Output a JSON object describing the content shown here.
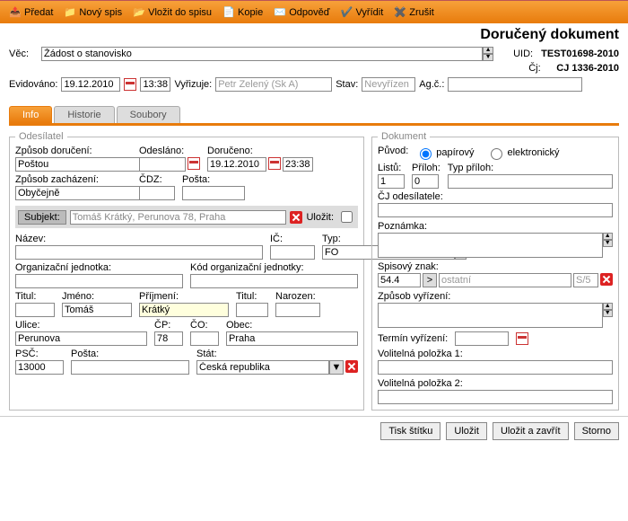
{
  "toolbar": {
    "predat": "Předat",
    "novy_spis": "Nový spis",
    "vlozit": "Vložit do spisu",
    "kopie": "Kopie",
    "odpoved": "Odpověď",
    "vyridit": "Vyřídit",
    "zrusit": "Zrušit"
  },
  "title": "Doručený dokument",
  "header": {
    "vec_lbl": "Věc:",
    "vec_val": "Žádost o stanovisko",
    "uid_lbl": "UID:",
    "uid_val": "TEST01698-2010",
    "cj_lbl": "Čj:",
    "cj_val": "CJ 1336-2010",
    "evidovano_lbl": "Evidováno:",
    "evidovano_date": "19.12.2010",
    "evidovano_time": "13:38",
    "vyrizuje_lbl": "Vyřizuje:",
    "vyrizuje_val": "Petr Zelený (Sk A)",
    "stav_lbl": "Stav:",
    "stav_val": "Nevyřízen",
    "agc_lbl": "Ag.č.:",
    "agc_val": ""
  },
  "tabs": {
    "info": "Info",
    "historie": "Historie",
    "soubory": "Soubory"
  },
  "odesilatel": {
    "legend": "Odesílatel",
    "zpusob_doruceni_lbl": "Způsob doručení:",
    "zpusob_doruceni_val": "Poštou",
    "odeslano_lbl": "Odesláno:",
    "odeslano_val": "",
    "doruceno_lbl": "Doručeno:",
    "doruceno_date": "19.12.2010",
    "doruceno_time": "23:38",
    "zpusob_zachazeni_lbl": "Způsob zacházení:",
    "zpusob_zachazeni_val": "Obyčejně",
    "cdz_lbl": "ČDZ:",
    "cdz_val": "",
    "posta_lbl": "Pošta:",
    "posta_val": "",
    "subjekt_btn": "Subjekt:",
    "subjekt_val": "Tomáš Krátký, Perunova 78, Praha",
    "ulozit_lbl": "Uložit:",
    "nazev_lbl": "Název:",
    "nazev_val": "",
    "ic_lbl": "IČ:",
    "ic_val": "",
    "typ_lbl": "Typ:",
    "typ_val": "FO",
    "orgjedn_lbl": "Organizační jednotka:",
    "orgjedn_val": "",
    "kodorg_lbl": "Kód organizační jednotky:",
    "kodorg_val": "",
    "titul_lbl": "Titul:",
    "titul_val": "",
    "jmeno_lbl": "Jméno:",
    "jmeno_val": "Tomáš",
    "prijmeni_lbl": "Příjmení:",
    "prijmeni_val": "Krátký",
    "titul2_lbl": "Titul:",
    "titul2_val": "",
    "narozen_lbl": "Narozen:",
    "narozen_val": "",
    "ulice_lbl": "Ulice:",
    "ulice_val": "Perunova",
    "cp_lbl": "ČP:",
    "cp_val": "78",
    "co_lbl": "ČO:",
    "co_val": "",
    "obec_lbl": "Obec:",
    "obec_val": "Praha",
    "psc_lbl": "PSČ:",
    "psc_val": "13000",
    "posta2_lbl": "Pošta:",
    "posta2_val": "",
    "stat_lbl": "Stát:",
    "stat_val": "Česká republika"
  },
  "dokument": {
    "legend": "Dokument",
    "puvod_lbl": "Původ:",
    "puvod_papir": "papírový",
    "puvod_el": "elektronický",
    "listu_lbl": "Listů:",
    "listu_val": "1",
    "priloh_lbl": "Příloh:",
    "priloh_val": "0",
    "typ_priloh_lbl": "Typ příloh:",
    "typ_priloh_val": "",
    "cj_odes_lbl": "ČJ odesílatele:",
    "cj_odes_val": "",
    "poznamka_lbl": "Poznámka:",
    "poznamka_val": "",
    "spisznak_lbl": "Spisový znak:",
    "spisznak_val": "54.4",
    "spisznak_desc": "ostatní",
    "spisznak_code": "S/5",
    "zpusob_vyr_lbl": "Způsob vyřízení:",
    "zpusob_vyr_val": "",
    "termin_vyr_lbl": "Termín vyřízení:",
    "termin_vyr_val": "",
    "vol1_lbl": "Volitelná položka 1:",
    "vol1_val": "",
    "vol2_lbl": "Volitelná položka 2:",
    "vol2_val": ""
  },
  "footer": {
    "tisk": "Tisk štítku",
    "ulozit": "Uložit",
    "ulozit_zavrit": "Uložit a zavřít",
    "storno": "Storno"
  }
}
